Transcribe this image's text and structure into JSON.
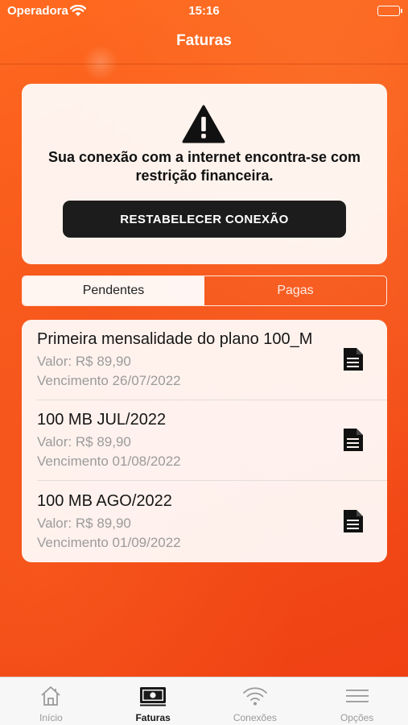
{
  "status_bar": {
    "carrier": "Operadora",
    "time": "15:16"
  },
  "nav": {
    "title": "Faturas"
  },
  "alert": {
    "icon": "warning-icon",
    "message": "Sua conexão com a internet encontra-se com restrição financeira.",
    "button_label": "RESTABELECER CONEXÃO"
  },
  "segments": {
    "pending": "Pendentes",
    "paid": "Pagas",
    "selected": "Pendentes"
  },
  "invoices": [
    {
      "title": "Primeira mensalidade do plano 100_M",
      "value": "Valor: R$ 89,90",
      "due": "Vencimento 26/07/2022"
    },
    {
      "title": "100 MB JUL/2022",
      "value": "Valor: R$ 89,90",
      "due": "Vencimento 01/08/2022"
    },
    {
      "title": "100 MB AGO/2022",
      "value": "Valor: R$ 89,90",
      "due": "Vencimento 01/09/2022"
    }
  ],
  "tabs": [
    {
      "label": "Início",
      "icon": "home-icon"
    },
    {
      "label": "Faturas",
      "icon": "invoice-icon"
    },
    {
      "label": "Conexões",
      "icon": "wifi-icon"
    },
    {
      "label": "Opções",
      "icon": "menu-icon"
    }
  ],
  "colors": {
    "background": "#f5511a",
    "button": "#1c1c1c",
    "card": "#fdf3f0"
  }
}
